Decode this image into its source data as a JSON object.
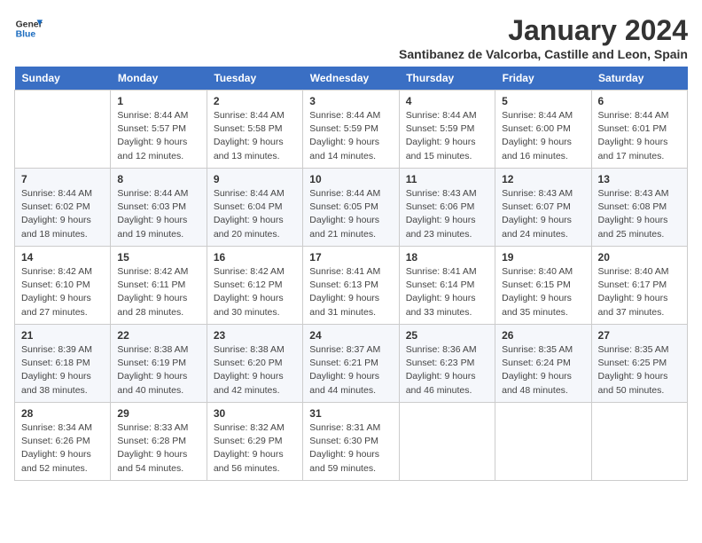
{
  "logo": {
    "general": "General",
    "blue": "Blue"
  },
  "title": "January 2024",
  "subtitle": "Santibanez de Valcorba, Castille and Leon, Spain",
  "days_of_week": [
    "Sunday",
    "Monday",
    "Tuesday",
    "Wednesday",
    "Thursday",
    "Friday",
    "Saturday"
  ],
  "weeks": [
    [
      {
        "num": "",
        "info": ""
      },
      {
        "num": "1",
        "info": "Sunrise: 8:44 AM\nSunset: 5:57 PM\nDaylight: 9 hours\nand 12 minutes."
      },
      {
        "num": "2",
        "info": "Sunrise: 8:44 AM\nSunset: 5:58 PM\nDaylight: 9 hours\nand 13 minutes."
      },
      {
        "num": "3",
        "info": "Sunrise: 8:44 AM\nSunset: 5:59 PM\nDaylight: 9 hours\nand 14 minutes."
      },
      {
        "num": "4",
        "info": "Sunrise: 8:44 AM\nSunset: 5:59 PM\nDaylight: 9 hours\nand 15 minutes."
      },
      {
        "num": "5",
        "info": "Sunrise: 8:44 AM\nSunset: 6:00 PM\nDaylight: 9 hours\nand 16 minutes."
      },
      {
        "num": "6",
        "info": "Sunrise: 8:44 AM\nSunset: 6:01 PM\nDaylight: 9 hours\nand 17 minutes."
      }
    ],
    [
      {
        "num": "7",
        "info": "Sunrise: 8:44 AM\nSunset: 6:02 PM\nDaylight: 9 hours\nand 18 minutes."
      },
      {
        "num": "8",
        "info": "Sunrise: 8:44 AM\nSunset: 6:03 PM\nDaylight: 9 hours\nand 19 minutes."
      },
      {
        "num": "9",
        "info": "Sunrise: 8:44 AM\nSunset: 6:04 PM\nDaylight: 9 hours\nand 20 minutes."
      },
      {
        "num": "10",
        "info": "Sunrise: 8:44 AM\nSunset: 6:05 PM\nDaylight: 9 hours\nand 21 minutes."
      },
      {
        "num": "11",
        "info": "Sunrise: 8:43 AM\nSunset: 6:06 PM\nDaylight: 9 hours\nand 23 minutes."
      },
      {
        "num": "12",
        "info": "Sunrise: 8:43 AM\nSunset: 6:07 PM\nDaylight: 9 hours\nand 24 minutes."
      },
      {
        "num": "13",
        "info": "Sunrise: 8:43 AM\nSunset: 6:08 PM\nDaylight: 9 hours\nand 25 minutes."
      }
    ],
    [
      {
        "num": "14",
        "info": "Sunrise: 8:42 AM\nSunset: 6:10 PM\nDaylight: 9 hours\nand 27 minutes."
      },
      {
        "num": "15",
        "info": "Sunrise: 8:42 AM\nSunset: 6:11 PM\nDaylight: 9 hours\nand 28 minutes."
      },
      {
        "num": "16",
        "info": "Sunrise: 8:42 AM\nSunset: 6:12 PM\nDaylight: 9 hours\nand 30 minutes."
      },
      {
        "num": "17",
        "info": "Sunrise: 8:41 AM\nSunset: 6:13 PM\nDaylight: 9 hours\nand 31 minutes."
      },
      {
        "num": "18",
        "info": "Sunrise: 8:41 AM\nSunset: 6:14 PM\nDaylight: 9 hours\nand 33 minutes."
      },
      {
        "num": "19",
        "info": "Sunrise: 8:40 AM\nSunset: 6:15 PM\nDaylight: 9 hours\nand 35 minutes."
      },
      {
        "num": "20",
        "info": "Sunrise: 8:40 AM\nSunset: 6:17 PM\nDaylight: 9 hours\nand 37 minutes."
      }
    ],
    [
      {
        "num": "21",
        "info": "Sunrise: 8:39 AM\nSunset: 6:18 PM\nDaylight: 9 hours\nand 38 minutes."
      },
      {
        "num": "22",
        "info": "Sunrise: 8:38 AM\nSunset: 6:19 PM\nDaylight: 9 hours\nand 40 minutes."
      },
      {
        "num": "23",
        "info": "Sunrise: 8:38 AM\nSunset: 6:20 PM\nDaylight: 9 hours\nand 42 minutes."
      },
      {
        "num": "24",
        "info": "Sunrise: 8:37 AM\nSunset: 6:21 PM\nDaylight: 9 hours\nand 44 minutes."
      },
      {
        "num": "25",
        "info": "Sunrise: 8:36 AM\nSunset: 6:23 PM\nDaylight: 9 hours\nand 46 minutes."
      },
      {
        "num": "26",
        "info": "Sunrise: 8:35 AM\nSunset: 6:24 PM\nDaylight: 9 hours\nand 48 minutes."
      },
      {
        "num": "27",
        "info": "Sunrise: 8:35 AM\nSunset: 6:25 PM\nDaylight: 9 hours\nand 50 minutes."
      }
    ],
    [
      {
        "num": "28",
        "info": "Sunrise: 8:34 AM\nSunset: 6:26 PM\nDaylight: 9 hours\nand 52 minutes."
      },
      {
        "num": "29",
        "info": "Sunrise: 8:33 AM\nSunset: 6:28 PM\nDaylight: 9 hours\nand 54 minutes."
      },
      {
        "num": "30",
        "info": "Sunrise: 8:32 AM\nSunset: 6:29 PM\nDaylight: 9 hours\nand 56 minutes."
      },
      {
        "num": "31",
        "info": "Sunrise: 8:31 AM\nSunset: 6:30 PM\nDaylight: 9 hours\nand 59 minutes."
      },
      {
        "num": "",
        "info": ""
      },
      {
        "num": "",
        "info": ""
      },
      {
        "num": "",
        "info": ""
      }
    ]
  ]
}
